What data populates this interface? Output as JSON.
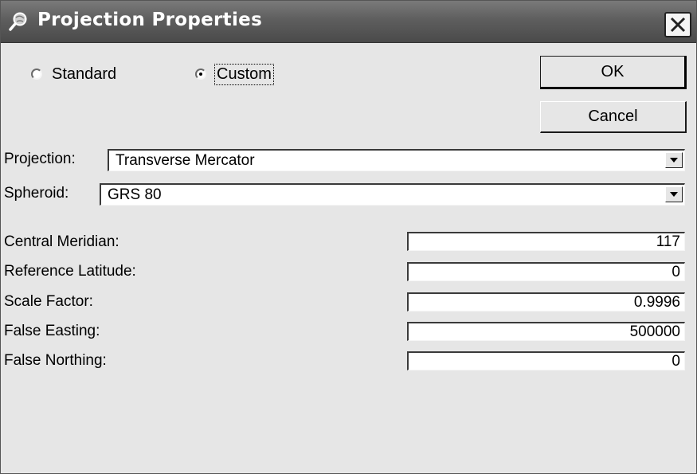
{
  "window": {
    "title": "Projection Properties",
    "icon": "magnifier-globe-icon",
    "close_icon": "close-icon"
  },
  "mode": {
    "options": [
      {
        "label": "Standard",
        "selected": false
      },
      {
        "label": "Custom",
        "selected": true
      }
    ]
  },
  "buttons": {
    "ok": "OK",
    "cancel": "Cancel"
  },
  "projection": {
    "label": "Projection:",
    "value": "Transverse Mercator"
  },
  "spheroid": {
    "label": "Spheroid:",
    "value": "GRS 80"
  },
  "parameters": [
    {
      "label": "Central Meridian:",
      "value": "117"
    },
    {
      "label": "Reference Latitude:",
      "value": "0"
    },
    {
      "label": "Scale Factor:",
      "value": "0.9996"
    },
    {
      "label": "False Easting:",
      "value": "500000"
    },
    {
      "label": "False Northing:",
      "value": "0"
    }
  ]
}
